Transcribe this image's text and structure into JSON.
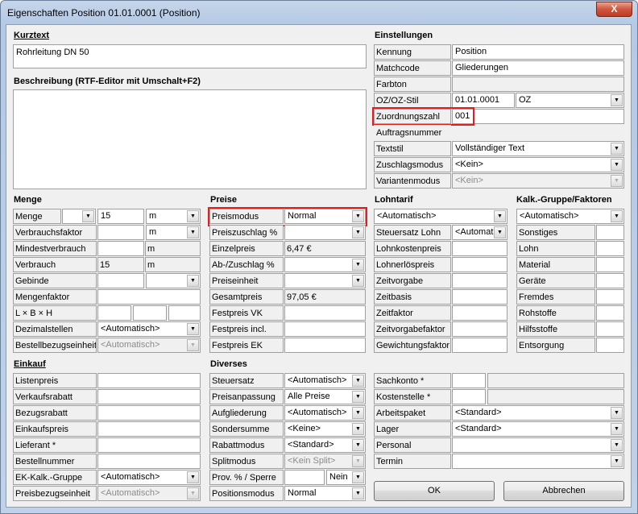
{
  "window": {
    "title": "Eigenschaften Position 01.01.0001 (Position)",
    "close": "X"
  },
  "kurztext": {
    "label": "Kurztext",
    "value": "Rohrleitung DN 50"
  },
  "beschreibung": {
    "label": "Beschreibung (RTF-Editor mit Umschalt+F2)",
    "value": ""
  },
  "einstellungen": {
    "label": "Einstellungen",
    "kennung": {
      "label": "Kennung",
      "value": "Position"
    },
    "matchcode": {
      "label": "Matchcode",
      "value": "Gliederungen"
    },
    "farbton": {
      "label": "Farbton"
    },
    "ozstil": {
      "label": "OZ/OZ-Stil",
      "value": "01.01.0001",
      "stil": "OZ"
    },
    "zuordnungszahl": {
      "label": "Zuordnungszahl",
      "value": "001"
    },
    "auftragsnummer": {
      "label": "Auftragsnummer"
    },
    "textstil": {
      "label": "Textstil",
      "value": "Vollständiger Text"
    },
    "zuschlagsmodus": {
      "label": "Zuschlagsmodus",
      "value": "<Kein>"
    },
    "variantenmodus": {
      "label": "Variantenmodus",
      "value": "<Kein>"
    }
  },
  "menge": {
    "label": "Menge",
    "menge": {
      "label": "Menge",
      "value": "15",
      "unit": "m"
    },
    "verbrauchsfaktor": {
      "label": "Verbrauchsfaktor",
      "unit": "m"
    },
    "mindestverbrauch": {
      "label": "Mindestverbrauch",
      "unit": "m"
    },
    "verbrauch": {
      "label": "Verbrauch",
      "value": "15",
      "unit": "m"
    },
    "gebinde": {
      "label": "Gebinde"
    },
    "mengenfaktor": {
      "label": "Mengenfaktor"
    },
    "lbh": {
      "label": "L × B × H"
    },
    "dezimalstellen": {
      "label": "Dezimalstellen",
      "value": "<Automatisch>"
    },
    "bestellbezugseinheit": {
      "label": "Bestellbezugseinheit",
      "value": "<Automatisch>"
    }
  },
  "preise": {
    "label": "Preise",
    "preismodus": {
      "label": "Preismodus",
      "value": "Normal"
    },
    "preiszuschlag": {
      "label": "Preiszuschlag %"
    },
    "einzelpreis": {
      "label": "Einzelpreis",
      "value": "6,47 €"
    },
    "abzuschlag": {
      "label": "Ab-/Zuschlag %"
    },
    "preiseinheit": {
      "label": "Preiseinheit"
    },
    "gesamtpreis": {
      "label": "Gesamtpreis",
      "value": "97,05 €"
    },
    "festpreisvk": {
      "label": "Festpreis VK"
    },
    "festpreisincl": {
      "label": "Festpreis incl."
    },
    "festpreisek": {
      "label": "Festpreis EK"
    }
  },
  "lohntarif": {
    "label": "Lohntarif",
    "value": "<Automatisch>",
    "steuersatzlohn": {
      "label": "Steuersatz Lohn",
      "value": "<Automat"
    },
    "rows": [
      "Lohnkostenpreis",
      "Lohnerlöspreis",
      "Zeitvorgabe",
      "Zeitbasis",
      "Zeitfaktor",
      "Zeitvorgabefaktor",
      "Gewichtungsfaktor"
    ]
  },
  "kalk": {
    "label": "Kalk.-Gruppe/Faktoren",
    "value": "<Automatisch>",
    "rows": [
      "Sonstiges",
      "Lohn",
      "Material",
      "Geräte",
      "Fremdes",
      "Rohstoffe",
      "Hilfsstoffe",
      "Entsorgung"
    ]
  },
  "einkauf": {
    "label": "Einkauf",
    "rows": [
      "Listenpreis",
      "Verkaufsrabatt",
      "Bezugsrabatt",
      "Einkaufspreis",
      "Lieferant *",
      "Bestellnummer"
    ],
    "ekkalk": {
      "label": "EK-Kalk.-Gruppe",
      "value": "<Automatisch>"
    },
    "preisbezugseinheit": {
      "label": "Preisbezugseinheit",
      "value": "<Automatisch>"
    }
  },
  "diverses": {
    "label": "Diverses",
    "steuersatz": {
      "label": "Steuersatz",
      "value": "<Automatisch>"
    },
    "preisanpassung": {
      "label": "Preisanpassung",
      "value": "Alle Preise"
    },
    "aufgliederung": {
      "label": "Aufgliederung",
      "value": "<Automatisch>"
    },
    "sondersumme": {
      "label": "Sondersumme",
      "value": "<Keine>"
    },
    "rabattmodus": {
      "label": "Rabattmodus",
      "value": "<Standard>"
    },
    "splitmodus": {
      "label": "Splitmodus",
      "value": "<Kein Split>"
    },
    "prov": {
      "label": "Prov. % / Sperre",
      "value": "Nein"
    },
    "positionsmodus": {
      "label": "Positionsmodus",
      "value": "Normal"
    }
  },
  "right": {
    "sachkonto": {
      "label": "Sachkonto *"
    },
    "kostenstelle": {
      "label": "Kostenstelle *"
    },
    "arbeitspaket": {
      "label": "Arbeitspaket",
      "value": "<Standard>"
    },
    "lager": {
      "label": "Lager",
      "value": "<Standard>"
    },
    "personal": {
      "label": "Personal"
    },
    "termin": {
      "label": "Termin"
    }
  },
  "buttons": {
    "ok": "OK",
    "cancel": "Abbrechen"
  },
  "colors": {
    "highlight": "#e02020"
  }
}
